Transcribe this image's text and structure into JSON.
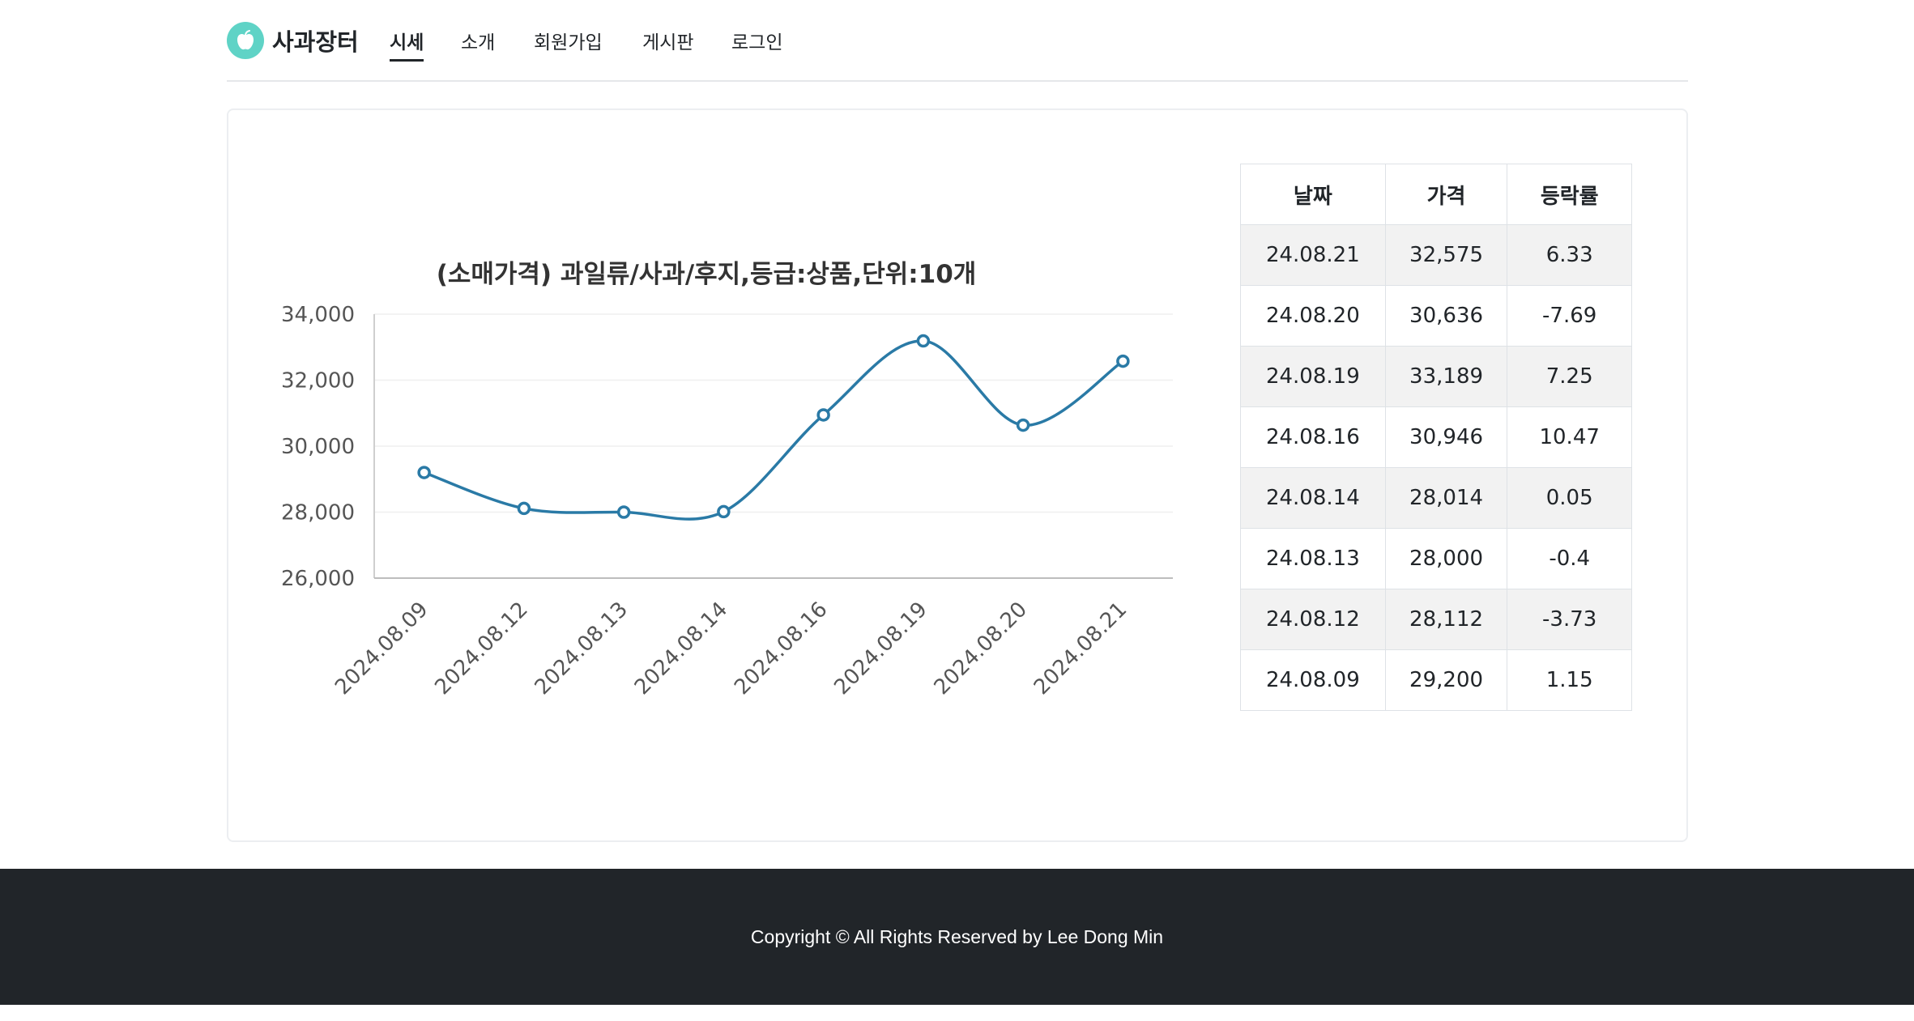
{
  "header": {
    "brand": "사과장터",
    "nav": [
      {
        "label": "시세",
        "active": true
      },
      {
        "label": "소개",
        "active": false
      },
      {
        "label": "회원가입",
        "active": false
      },
      {
        "label": "게시판",
        "active": false
      },
      {
        "label": "로그인",
        "active": false
      }
    ]
  },
  "colors": {
    "brand_icon": "#5fd3c6",
    "series_line": "#2a7aa6",
    "footer_bg": "#212529"
  },
  "chart_data": {
    "type": "line",
    "title": "(소매가격) 과일류/사과/후지,등급:상품,단위:10개",
    "x": [
      "2024.08.09",
      "2024.08.12",
      "2024.08.13",
      "2024.08.14",
      "2024.08.16",
      "2024.08.19",
      "2024.08.20",
      "2024.08.21"
    ],
    "values": [
      29200,
      28112,
      28000,
      28014,
      30946,
      33189,
      30636,
      32575
    ],
    "ylim": [
      26000,
      34000
    ],
    "yticks": [
      26000,
      28000,
      30000,
      32000,
      34000
    ],
    "ytick_labels": [
      "26,000",
      "28,000",
      "30,000",
      "32,000",
      "34,000"
    ],
    "xlabel": "",
    "ylabel": "",
    "curve": "smooth",
    "markers": "open-circle",
    "grid": "horizontal",
    "legend": "none"
  },
  "table": {
    "headers": [
      "날짜",
      "가격",
      "등락률"
    ],
    "rows": [
      [
        "24.08.21",
        "32,575",
        "6.33"
      ],
      [
        "24.08.20",
        "30,636",
        "-7.69"
      ],
      [
        "24.08.19",
        "33,189",
        "7.25"
      ],
      [
        "24.08.16",
        "30,946",
        "10.47"
      ],
      [
        "24.08.14",
        "28,014",
        "0.05"
      ],
      [
        "24.08.13",
        "28,000",
        "-0.4"
      ],
      [
        "24.08.12",
        "28,112",
        "-3.73"
      ],
      [
        "24.08.09",
        "29,200",
        "1.15"
      ]
    ]
  },
  "footer": {
    "copyright": "Copyright © All Rights Reserved by Lee Dong Min"
  }
}
